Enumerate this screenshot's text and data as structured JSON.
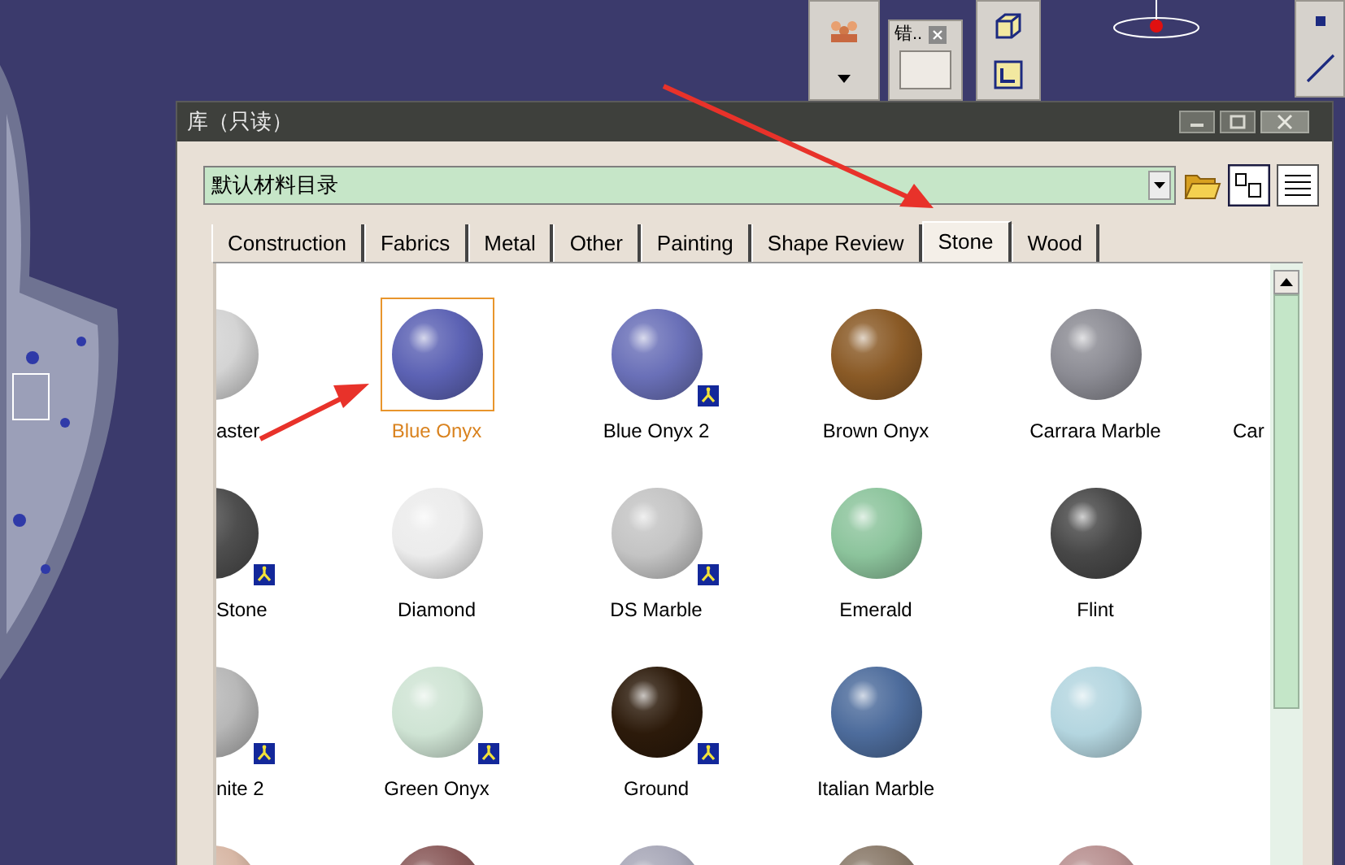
{
  "toolbar": {
    "title": "错.."
  },
  "dialog": {
    "title": "库（只读）",
    "catalog": {
      "value": "默认材料目录"
    },
    "tabs": [
      {
        "label": "Construction",
        "selected": false
      },
      {
        "label": "Fabrics",
        "selected": false
      },
      {
        "label": "Metal",
        "selected": false
      },
      {
        "label": "Other",
        "selected": false
      },
      {
        "label": "Painting",
        "selected": false
      },
      {
        "label": "Shape Review",
        "selected": false
      },
      {
        "label": "Stone",
        "selected": true
      },
      {
        "label": "Wood",
        "selected": false
      }
    ],
    "materials": [
      [
        {
          "name": "aster",
          "color": "#d4d4d4",
          "badge": false,
          "selected": false
        },
        {
          "name": "Blue Onyx",
          "color": "#5c62b4",
          "badge": false,
          "selected": true
        },
        {
          "name": "Blue Onyx 2",
          "color": "#6a70b8",
          "badge": true,
          "selected": false
        },
        {
          "name": "Brown Onyx",
          "color": "#8a5a26",
          "badge": false,
          "selected": false
        },
        {
          "name": "Carrara Marble",
          "color": "#8c8c94",
          "badge": false,
          "selected": false
        },
        {
          "name": "Car"
        }
      ],
      [
        {
          "name": "Stone",
          "color": "#4e4e4e",
          "badge": true,
          "selected": false
        },
        {
          "name": "Diamond",
          "color": "#ececec",
          "badge": false,
          "selected": false
        },
        {
          "name": "DS Marble",
          "color": "#c4c4c4",
          "badge": true,
          "selected": false
        },
        {
          "name": "Emerald",
          "color": "#8cc49c",
          "badge": false,
          "selected": false
        },
        {
          "name": "Flint",
          "color": "#474747",
          "badge": false,
          "selected": false
        }
      ],
      [
        {
          "name": "nite 2",
          "color": "#b8b8b8",
          "badge": true,
          "selected": false
        },
        {
          "name": "Green Onyx",
          "color": "#cfe4d4",
          "badge": true,
          "selected": false
        },
        {
          "name": "Ground",
          "color": "#2c1a0a",
          "badge": true,
          "selected": false
        },
        {
          "name": "Italian Marble",
          "color": "#4d6c9c",
          "badge": false,
          "selected": false
        },
        {
          "color": "#b4d6e0",
          "badge": false,
          "selected": false
        }
      ],
      [
        {
          "color": "#d8b8a6",
          "selected": false
        },
        {
          "color": "#8a5a5a",
          "selected": false
        },
        {
          "color": "#a8a8b8",
          "selected": false
        },
        {
          "color": "#8a7a6a",
          "selected": false
        },
        {
          "color": "#b89090",
          "selected": false
        }
      ]
    ]
  }
}
